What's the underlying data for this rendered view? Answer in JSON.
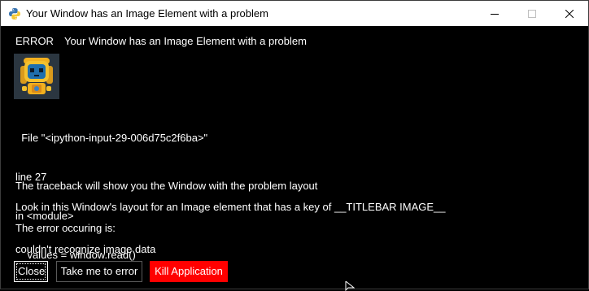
{
  "window": {
    "title": "Your Window has an Image Element with a problem",
    "controls": {
      "minimize_icon": "minimize-icon",
      "maximize_icon": "maximize-icon",
      "close_icon": "close-icon"
    }
  },
  "content": {
    "error_label": "ERROR",
    "error_message": "Your Window has an Image Element with a problem",
    "traceback_lines": [
      "  File \"<ipython-input-29-006d75c2f6ba>\"",
      "line 27",
      "in <module>",
      "    values = window.read()"
    ],
    "info_lines": [
      "The traceback will show you the Window with the problem layout",
      "Look in this Window's layout for an Image element that has a key of __TITLEBAR IMAGE__",
      "The error occuring is:",
      "couldn't recognize image data"
    ]
  },
  "buttons": {
    "close_label": "Close",
    "take_me_label": "Take me to error",
    "kill_label": "Kill Application"
  },
  "colors": {
    "background": "#000000",
    "text": "#ffffff",
    "titlebar": "#ffffff",
    "kill_button": "#ff0000"
  }
}
